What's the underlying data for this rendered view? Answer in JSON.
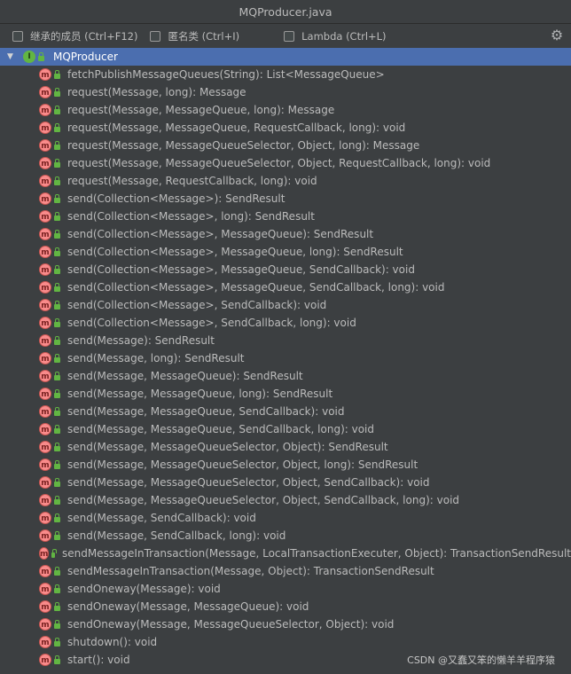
{
  "window": {
    "title": "MQProducer.java"
  },
  "toolbar": {
    "options": [
      {
        "label": "继承的成员 (Ctrl+F12)"
      },
      {
        "label": "匿名类 (Ctrl+I)"
      },
      {
        "label": "Lambda (Ctrl+L)"
      }
    ],
    "settings_icon": "gear-icon"
  },
  "tree": {
    "root": {
      "label": "MQProducer",
      "icon": "interface-icon"
    },
    "items": [
      "fetchPublishMessageQueues(String): List<MessageQueue>",
      "request(Message, long): Message",
      "request(Message, MessageQueue, long): Message",
      "request(Message, MessageQueue, RequestCallback, long): void",
      "request(Message, MessageQueueSelector, Object, long): Message",
      "request(Message, MessageQueueSelector, Object, RequestCallback, long): void",
      "request(Message, RequestCallback, long): void",
      "send(Collection<Message>): SendResult",
      "send(Collection<Message>, long): SendResult",
      "send(Collection<Message>, MessageQueue): SendResult",
      "send(Collection<Message>, MessageQueue, long): SendResult",
      "send(Collection<Message>, MessageQueue, SendCallback): void",
      "send(Collection<Message>, MessageQueue, SendCallback, long): void",
      "send(Collection<Message>, SendCallback): void",
      "send(Collection<Message>, SendCallback, long): void",
      "send(Message): SendResult",
      "send(Message, long): SendResult",
      "send(Message, MessageQueue): SendResult",
      "send(Message, MessageQueue, long): SendResult",
      "send(Message, MessageQueue, SendCallback): void",
      "send(Message, MessageQueue, SendCallback, long): void",
      "send(Message, MessageQueueSelector, Object): SendResult",
      "send(Message, MessageQueueSelector, Object, long): SendResult",
      "send(Message, MessageQueueSelector, Object, SendCallback): void",
      "send(Message, MessageQueueSelector, Object, SendCallback, long): void",
      "send(Message, SendCallback): void",
      "send(Message, SendCallback, long): void",
      "sendMessageInTransaction(Message, LocalTransactionExecuter, Object): TransactionSendResult",
      "sendMessageInTransaction(Message, Object): TransactionSendResult",
      "sendOneway(Message): void",
      "sendOneway(Message, MessageQueue): void",
      "sendOneway(Message, MessageQueueSelector, Object): void",
      "shutdown(): void",
      "start(): void"
    ]
  },
  "watermark": "CSDN @又蠢又笨的懒羊羊程序猿",
  "colors": {
    "background": "#3c3f41",
    "selection": "#4b6eaf",
    "method_icon": "#f98b8b",
    "interface_icon": "#62b543"
  }
}
